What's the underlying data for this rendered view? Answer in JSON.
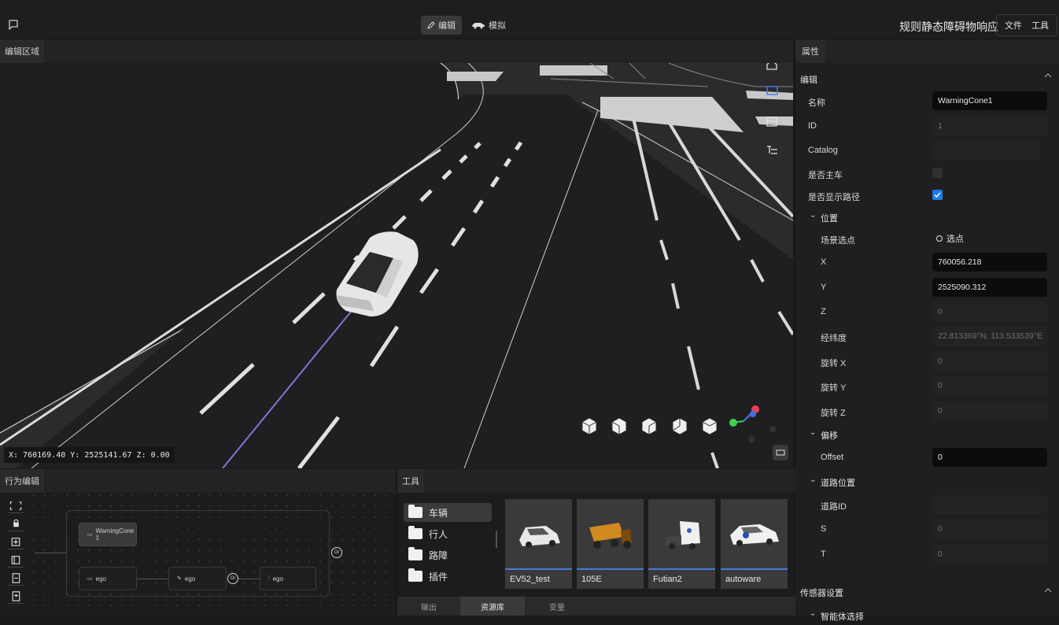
{
  "topbar": {
    "mode_edit": "编辑",
    "mode_simulate": "模拟",
    "scenario_title": "规则静态障碍物响应",
    "menu_file": "文件",
    "menu_tools": "工具"
  },
  "editor": {
    "panel_title": "编辑区域",
    "coord_readout": "X: 760169.40 Y: 2525141.67 Z: 0.00"
  },
  "properties": {
    "tab": "属性",
    "edit_section": "编辑",
    "name_label": "名称",
    "name_value": "WarningCone1",
    "id_label": "ID",
    "id_value": "1",
    "catalog_label": "Catalog",
    "catalog_value": "",
    "is_ego_label": "是否主车",
    "is_ego": false,
    "show_path_label": "是否显示路径",
    "show_path": true,
    "position_group": "位置",
    "pick_label": "场景选点",
    "pick_button": "选点",
    "x_label": "X",
    "x_value": "760056.218",
    "y_label": "Y",
    "y_value": "2525090.312",
    "z_label": "Z",
    "z_value": "0",
    "latlon_label": "经纬度",
    "latlon_value": "22.813369°N, 113.533539°E",
    "rotx_label": "旋转 X",
    "rotx_value": "0",
    "roty_label": "旋转 Y",
    "roty_value": "0",
    "rotz_label": "旋转 Z",
    "rotz_value": "0",
    "offset_group": "偏移",
    "offset_label": "Offset",
    "offset_value": "0",
    "road_group": "道路位置",
    "road_id_label": "道路ID",
    "road_id_value": "",
    "s_label": "S",
    "s_value": "0",
    "t_label": "T",
    "t_value": "0",
    "sensor_section": "传感器设置",
    "sensor_sub": "智能体选择"
  },
  "behavior": {
    "panel_title": "行为编辑",
    "node_warning": "WarningCone 1",
    "node_ego1": "ego",
    "node_ego2": "ego",
    "node_ego3": "ego",
    "or_label": "Or"
  },
  "tools": {
    "panel_title": "工具",
    "folders": [
      "车辆",
      "行人",
      "路障",
      "插件"
    ],
    "assets": [
      "EV52_test",
      "105E",
      "Futian2",
      "autoware"
    ],
    "tab_output": "输出",
    "tab_library": "资源库",
    "tab_variables": "变量"
  },
  "colors": {
    "accent_blue": "#1e7be8",
    "asset_bar": "#4a78d8",
    "trajectory": "#7a78d8",
    "gizmo_red": "#e8405a",
    "gizmo_green": "#40d050",
    "gizmo_blue": "#4070e8"
  }
}
